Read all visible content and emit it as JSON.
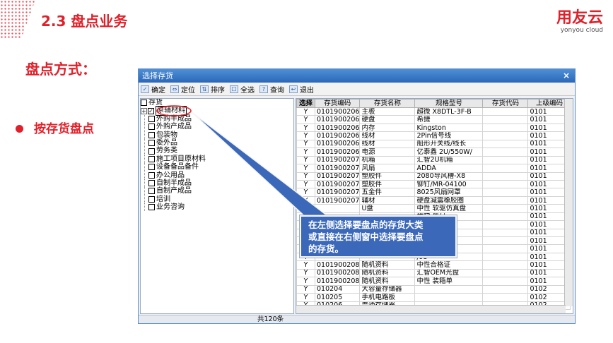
{
  "slide": {
    "title": "2.3 盘点业务",
    "logo_cn": "用友云",
    "logo_en": "yonyou cloud",
    "method_label": "盘点方式：",
    "bullet_text": "按存货盘点"
  },
  "window": {
    "title": "选择存货",
    "close": "×"
  },
  "toolbar": [
    {
      "icon": "confirm-icon",
      "glyph": "✓",
      "label": "确定"
    },
    {
      "icon": "locate-icon",
      "glyph": "⇔",
      "label": "定位"
    },
    {
      "icon": "sort-icon",
      "glyph": "⇅",
      "label": "排序"
    },
    {
      "icon": "select-all-icon",
      "glyph": "☐",
      "label": "全选"
    },
    {
      "icon": "query-icon",
      "glyph": "?",
      "label": "查询"
    },
    {
      "icon": "exit-icon",
      "glyph": "↩",
      "label": "退出"
    }
  ],
  "tree": {
    "root": "存货",
    "selected": "原辅材料",
    "items": [
      "外购半成品",
      "外购产成品",
      "包装物",
      "委外品",
      "劳务类",
      "施工项目原材料",
      "设备备品备件",
      "办公用品",
      "自制半成品",
      "自制产成品",
      "培训",
      "业务咨询"
    ]
  },
  "grid": {
    "columns": [
      "选择",
      "存货编码",
      "存货名称",
      "规格型号",
      "存货代码",
      "上级编码"
    ],
    "rows": [
      [
        "Y",
        "0101900206",
        "主板",
        "超微 X8DTL-3F-B",
        "",
        "0101"
      ],
      [
        "Y",
        "0101900206",
        "硬盘",
        "希捷",
        "",
        "0101"
      ],
      [
        "Y",
        "0101900206",
        "内存",
        "Kingston",
        "",
        "0101"
      ],
      [
        "Y",
        "0101900206",
        "线材",
        "2Pin信号线",
        "",
        "0101"
      ],
      [
        "Y",
        "0101900206",
        "线材",
        "船形开关线/线长",
        "",
        "0101"
      ],
      [
        "Y",
        "0101900206",
        "电源",
        "亿泰鑫 2U/550W/",
        "",
        "0101"
      ],
      [
        "Y",
        "0101900207",
        "机箱",
        "汇智2U机箱",
        "",
        "0101"
      ],
      [
        "Y",
        "0101900207",
        "风扇",
        "ADDA",
        "",
        "0101"
      ],
      [
        "Y",
        "0101900207",
        "塑胶件",
        "2080导风槽-X8",
        "",
        "0101"
      ],
      [
        "Y",
        "0101900207",
        "塑胶件",
        "铆钉/MR-04100",
        "",
        "0101"
      ],
      [
        "Y",
        "0101900207",
        "五金件",
        "8025风扇网罩",
        "",
        "0101"
      ],
      [
        "Y",
        "0101900207",
        "辅材",
        "硬盘减震橡胶圈",
        "",
        "0101"
      ],
      [
        "Y",
        "",
        "U盘",
        "中性 软驱仿真盘",
        "",
        "0101"
      ],
      [
        "Y",
        "",
        "",
        "横梯 黑/无",
        "",
        "0101"
      ],
      [
        "Y",
        "",
        "",
        "/光",
        "",
        "0101"
      ],
      [
        "Y",
        "",
        "",
        "",
        "",
        "0101"
      ],
      [
        "Y",
        "",
        "",
        "",
        "",
        "0101"
      ],
      [
        "Y",
        "",
        "",
        "雅",
        "",
        "0101"
      ],
      [
        "Y",
        "",
        "",
        "/95",
        "",
        "0101"
      ],
      [
        "Y",
        "0101900208",
        "随机资料",
        "中性合格证",
        "",
        "0101"
      ],
      [
        "Y",
        "0101900208",
        "随机资料",
        "汇智OEM光盘",
        "",
        "0101"
      ],
      [
        "Y",
        "0101900208",
        "随机资料",
        "中性 装箱单",
        "",
        "0101"
      ],
      [
        "Y",
        "010204",
        "大容量存储器",
        "",
        "",
        "0102"
      ],
      [
        "Y",
        "010205",
        "手机电路板",
        "",
        "",
        "0102"
      ],
      [
        "Y",
        "010206",
        "普通存储器",
        "",
        "",
        "0102"
      ]
    ]
  },
  "status": "共120条",
  "callout": {
    "lines": [
      "在左侧选择要盘点的存货大类",
      "或直接在右侧窗中选择要盘点",
      "的存货。"
    ]
  }
}
